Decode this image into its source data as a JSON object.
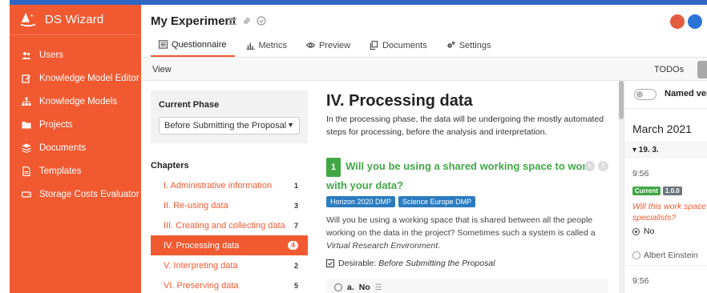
{
  "app": {
    "name": "DS Wizard"
  },
  "sidebar": {
    "items": [
      {
        "label": "Users",
        "icon": "users-icon"
      },
      {
        "label": "Knowledge Model Editor",
        "icon": "edit-icon"
      },
      {
        "label": "Knowledge Models",
        "icon": "sitemap-icon"
      },
      {
        "label": "Projects",
        "icon": "folder-icon"
      },
      {
        "label": "Documents",
        "icon": "layers-icon"
      },
      {
        "label": "Templates",
        "icon": "file-icon"
      },
      {
        "label": "Storage Costs Evaluator",
        "icon": "drive-icon"
      }
    ]
  },
  "header": {
    "title": "My Experiment"
  },
  "tabs": [
    {
      "label": "Questionnaire",
      "icon": "list-icon",
      "active": true
    },
    {
      "label": "Metrics",
      "icon": "chart-icon",
      "active": false
    },
    {
      "label": "Preview",
      "icon": "eye-icon",
      "active": false
    },
    {
      "label": "Documents",
      "icon": "copy-icon",
      "active": false
    },
    {
      "label": "Settings",
      "icon": "cogs-icon",
      "active": false
    }
  ],
  "viewbar": {
    "view_label": "View",
    "todos_label": "TODOs"
  },
  "phase": {
    "title": "Current Phase",
    "selected": "Before Submitting the Proposal"
  },
  "chapters": {
    "title": "Chapters",
    "items": [
      {
        "label": "I. Administrative information",
        "count": "1"
      },
      {
        "label": "II. Re-using data",
        "count": "3"
      },
      {
        "label": "III. Creating and collecting data",
        "count": "7"
      },
      {
        "label": "IV. Processing data",
        "count": "4",
        "active": true
      },
      {
        "label": "V. Interpreting data",
        "count": "2"
      },
      {
        "label": "VI. Preserving data",
        "count": "5"
      }
    ]
  },
  "content": {
    "heading": "IV. Processing data",
    "description": "In the processing phase, the data will be undergoing the mostly automated steps for processing, before the analysis and interpretation.",
    "question": {
      "number": "1",
      "title": "Will you be using a shared working space to work with your data?",
      "tags": [
        "Horizon 2020 DMP",
        "Science Europe DMP"
      ],
      "text_before": "Will you be using a working space that is shared between all the people working on the data in the project? Sometimes such a system is called a ",
      "text_italic": "Virtual Research Environment",
      "text_after": ".",
      "desirable_label": "Desirable:",
      "desirable_value": "Before Submitting the Proposal",
      "answer_letter": "a.",
      "answer_label": "No"
    }
  },
  "history": {
    "named_label": "Named ver",
    "month": "March 2021",
    "date": "▾ 19. 3.",
    "time1": "9:56",
    "badge_current": "Current",
    "badge_version": "1.0.0",
    "question": "Will this work space specialists?",
    "answer": "No",
    "user": "Albert Einstein",
    "time2": "9:56"
  }
}
